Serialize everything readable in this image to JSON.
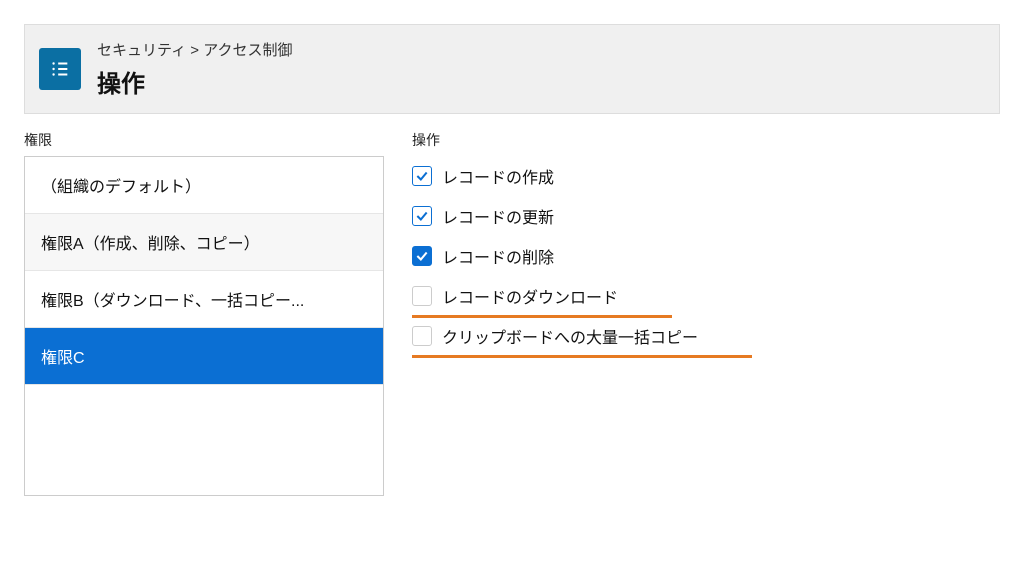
{
  "header": {
    "breadcrumb": "セキュリティ > アクセス制御",
    "title": "操作"
  },
  "columns": {
    "left_label": "権限",
    "right_label": "操作"
  },
  "permissions": [
    {
      "label": "（組織のデフォルト）"
    },
    {
      "label": "権限A（作成、削除、コピー）"
    },
    {
      "label": "権限B（ダウンロード、一括コピー..."
    },
    {
      "label": "権限C"
    }
  ],
  "selected_permission_index": 3,
  "operations": [
    {
      "label": "レコードの作成",
      "checked": true,
      "strong": false
    },
    {
      "label": "レコードの更新",
      "checked": true,
      "strong": false
    },
    {
      "label": "レコードの削除",
      "checked": true,
      "strong": true
    },
    {
      "label": "レコードのダウンロード",
      "checked": false,
      "strong": false,
      "highlight": "short"
    },
    {
      "label": "クリップボードへの大量一括コピー",
      "checked": false,
      "strong": false,
      "highlight": "long"
    }
  ],
  "colors": {
    "accent_blue": "#0b6fd3",
    "icon_blue": "#0b6fa3",
    "highlight_orange": "#e67a22"
  }
}
